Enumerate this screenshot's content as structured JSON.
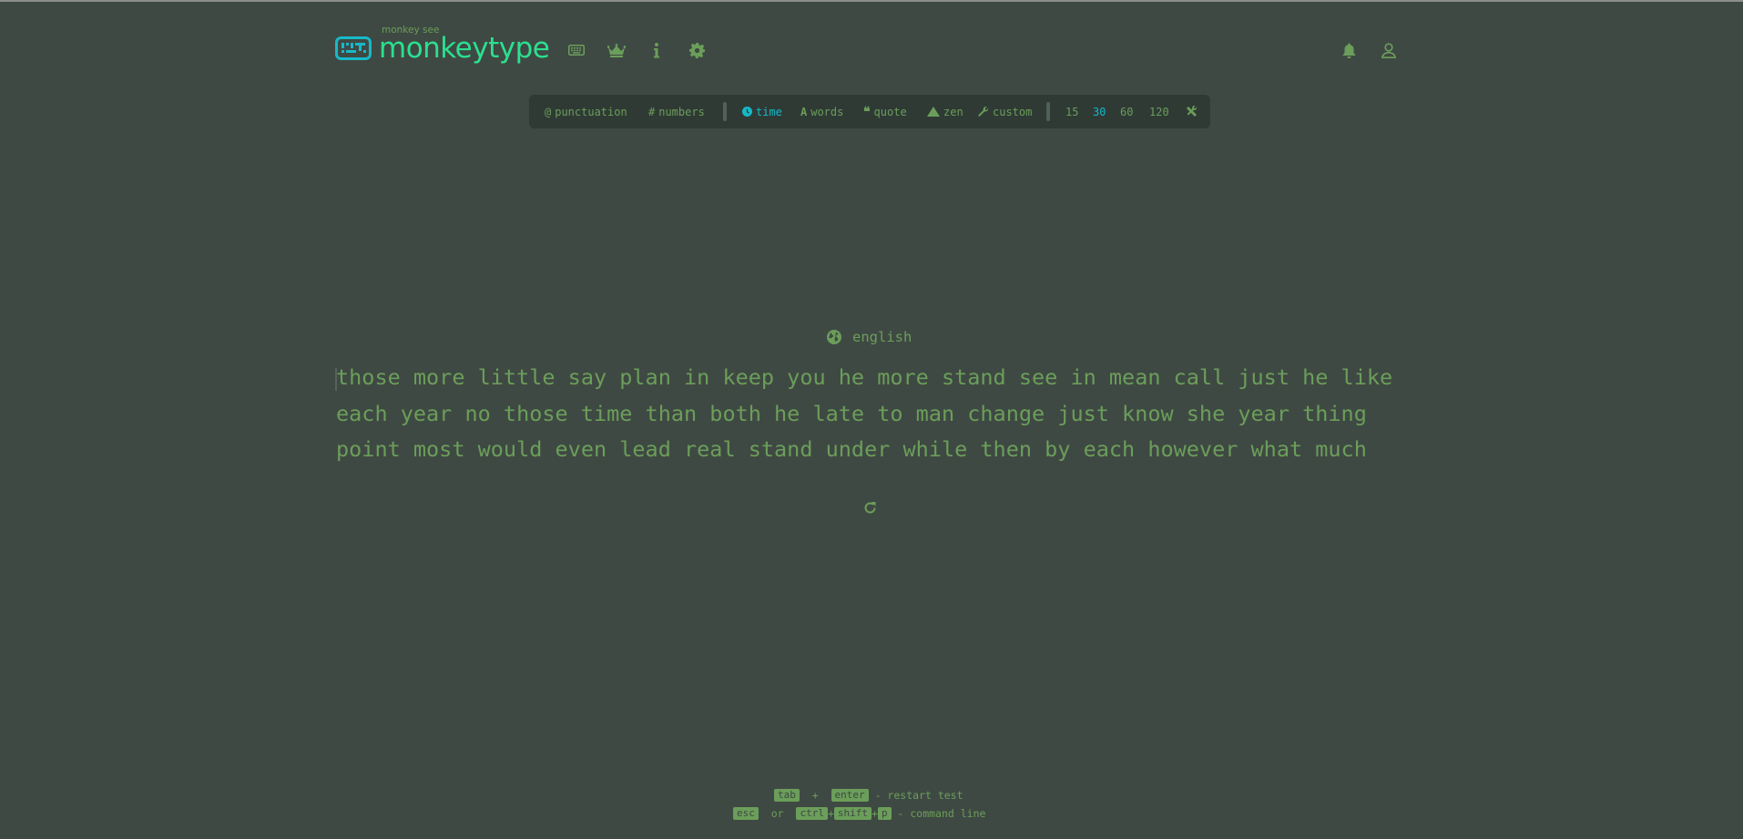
{
  "header": {
    "logo_sub": "monkey see",
    "logo_main": "monkeytype",
    "icons": [
      "keyboard-icon",
      "crown-icon",
      "info-icon",
      "gear-icon",
      "bell-icon",
      "user-icon"
    ]
  },
  "config": {
    "punctuation": "punctuation",
    "numbers": "numbers",
    "time": "time",
    "words": "words",
    "quote": "quote",
    "zen": "zen",
    "custom": "custom",
    "t15": "15",
    "t30": "30",
    "t60": "60",
    "t120": "120",
    "active_mode": "time",
    "active_time": "30"
  },
  "test": {
    "language": "english",
    "line1": "those more little say plan in keep you he more stand see in mean call just he like",
    "line2": "each year no those time than both he late to man change just know she year thing",
    "line3": "point most would even lead real stand under while then by each however what much"
  },
  "hints": {
    "tab": "tab",
    "plus": "+",
    "enter": "enter",
    "restart": " - restart test",
    "esc": "esc",
    "or": "or",
    "ctrl": "ctrl",
    "shift": "shift",
    "p": "p",
    "command": " - command line"
  },
  "colors": {
    "background": "#3f4943",
    "main": "#2ae08f",
    "sub": "#6b9e5a",
    "active": "#15b9c9"
  }
}
